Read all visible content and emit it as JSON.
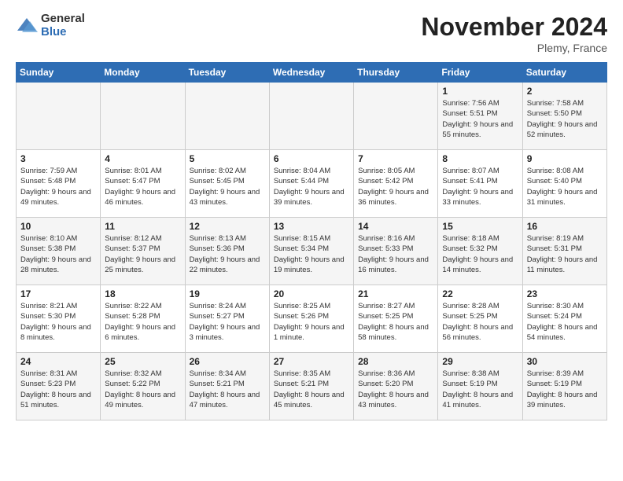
{
  "logo": {
    "general": "General",
    "blue": "Blue"
  },
  "header": {
    "month": "November 2024",
    "location": "Plemy, France"
  },
  "weekdays": [
    "Sunday",
    "Monday",
    "Tuesday",
    "Wednesday",
    "Thursday",
    "Friday",
    "Saturday"
  ],
  "weeks": [
    [
      {
        "day": "",
        "info": ""
      },
      {
        "day": "",
        "info": ""
      },
      {
        "day": "",
        "info": ""
      },
      {
        "day": "",
        "info": ""
      },
      {
        "day": "",
        "info": ""
      },
      {
        "day": "1",
        "info": "Sunrise: 7:56 AM\nSunset: 5:51 PM\nDaylight: 9 hours and 55 minutes."
      },
      {
        "day": "2",
        "info": "Sunrise: 7:58 AM\nSunset: 5:50 PM\nDaylight: 9 hours and 52 minutes."
      }
    ],
    [
      {
        "day": "3",
        "info": "Sunrise: 7:59 AM\nSunset: 5:48 PM\nDaylight: 9 hours and 49 minutes."
      },
      {
        "day": "4",
        "info": "Sunrise: 8:01 AM\nSunset: 5:47 PM\nDaylight: 9 hours and 46 minutes."
      },
      {
        "day": "5",
        "info": "Sunrise: 8:02 AM\nSunset: 5:45 PM\nDaylight: 9 hours and 43 minutes."
      },
      {
        "day": "6",
        "info": "Sunrise: 8:04 AM\nSunset: 5:44 PM\nDaylight: 9 hours and 39 minutes."
      },
      {
        "day": "7",
        "info": "Sunrise: 8:05 AM\nSunset: 5:42 PM\nDaylight: 9 hours and 36 minutes."
      },
      {
        "day": "8",
        "info": "Sunrise: 8:07 AM\nSunset: 5:41 PM\nDaylight: 9 hours and 33 minutes."
      },
      {
        "day": "9",
        "info": "Sunrise: 8:08 AM\nSunset: 5:40 PM\nDaylight: 9 hours and 31 minutes."
      }
    ],
    [
      {
        "day": "10",
        "info": "Sunrise: 8:10 AM\nSunset: 5:38 PM\nDaylight: 9 hours and 28 minutes."
      },
      {
        "day": "11",
        "info": "Sunrise: 8:12 AM\nSunset: 5:37 PM\nDaylight: 9 hours and 25 minutes."
      },
      {
        "day": "12",
        "info": "Sunrise: 8:13 AM\nSunset: 5:36 PM\nDaylight: 9 hours and 22 minutes."
      },
      {
        "day": "13",
        "info": "Sunrise: 8:15 AM\nSunset: 5:34 PM\nDaylight: 9 hours and 19 minutes."
      },
      {
        "day": "14",
        "info": "Sunrise: 8:16 AM\nSunset: 5:33 PM\nDaylight: 9 hours and 16 minutes."
      },
      {
        "day": "15",
        "info": "Sunrise: 8:18 AM\nSunset: 5:32 PM\nDaylight: 9 hours and 14 minutes."
      },
      {
        "day": "16",
        "info": "Sunrise: 8:19 AM\nSunset: 5:31 PM\nDaylight: 9 hours and 11 minutes."
      }
    ],
    [
      {
        "day": "17",
        "info": "Sunrise: 8:21 AM\nSunset: 5:30 PM\nDaylight: 9 hours and 8 minutes."
      },
      {
        "day": "18",
        "info": "Sunrise: 8:22 AM\nSunset: 5:28 PM\nDaylight: 9 hours and 6 minutes."
      },
      {
        "day": "19",
        "info": "Sunrise: 8:24 AM\nSunset: 5:27 PM\nDaylight: 9 hours and 3 minutes."
      },
      {
        "day": "20",
        "info": "Sunrise: 8:25 AM\nSunset: 5:26 PM\nDaylight: 9 hours and 1 minute."
      },
      {
        "day": "21",
        "info": "Sunrise: 8:27 AM\nSunset: 5:25 PM\nDaylight: 8 hours and 58 minutes."
      },
      {
        "day": "22",
        "info": "Sunrise: 8:28 AM\nSunset: 5:25 PM\nDaylight: 8 hours and 56 minutes."
      },
      {
        "day": "23",
        "info": "Sunrise: 8:30 AM\nSunset: 5:24 PM\nDaylight: 8 hours and 54 minutes."
      }
    ],
    [
      {
        "day": "24",
        "info": "Sunrise: 8:31 AM\nSunset: 5:23 PM\nDaylight: 8 hours and 51 minutes."
      },
      {
        "day": "25",
        "info": "Sunrise: 8:32 AM\nSunset: 5:22 PM\nDaylight: 8 hours and 49 minutes."
      },
      {
        "day": "26",
        "info": "Sunrise: 8:34 AM\nSunset: 5:21 PM\nDaylight: 8 hours and 47 minutes."
      },
      {
        "day": "27",
        "info": "Sunrise: 8:35 AM\nSunset: 5:21 PM\nDaylight: 8 hours and 45 minutes."
      },
      {
        "day": "28",
        "info": "Sunrise: 8:36 AM\nSunset: 5:20 PM\nDaylight: 8 hours and 43 minutes."
      },
      {
        "day": "29",
        "info": "Sunrise: 8:38 AM\nSunset: 5:19 PM\nDaylight: 8 hours and 41 minutes."
      },
      {
        "day": "30",
        "info": "Sunrise: 8:39 AM\nSunset: 5:19 PM\nDaylight: 8 hours and 39 minutes."
      }
    ]
  ]
}
